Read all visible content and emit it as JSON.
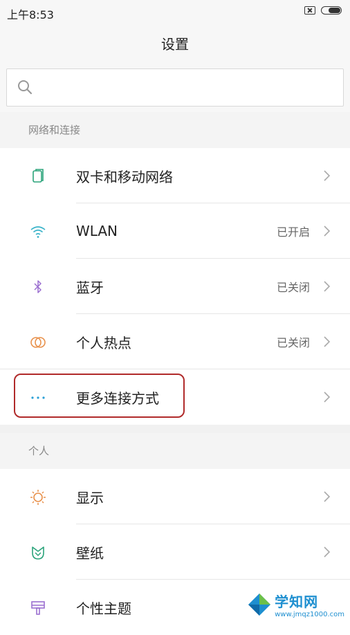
{
  "status_bar": {
    "time": "上午8:53"
  },
  "header": {
    "title": "设置"
  },
  "search": {
    "placeholder": ""
  },
  "sections": [
    {
      "title": "网络和连接",
      "items": [
        {
          "label": "双卡和移动网络",
          "value": "",
          "icon": "dual-sim-icon"
        },
        {
          "label": "WLAN",
          "value": "已开启",
          "icon": "wifi-icon"
        },
        {
          "label": "蓝牙",
          "value": "已关闭",
          "icon": "bluetooth-icon"
        },
        {
          "label": "个人热点",
          "value": "已关闭",
          "icon": "hotspot-icon"
        },
        {
          "label": "更多连接方式",
          "value": "",
          "icon": "more-dots-icon"
        }
      ]
    },
    {
      "title": "个人",
      "items": [
        {
          "label": "显示",
          "value": "",
          "icon": "display-sun-icon"
        },
        {
          "label": "壁纸",
          "value": "",
          "icon": "wallpaper-icon"
        },
        {
          "label": "个性主题",
          "value": "",
          "icon": "theme-brush-icon"
        }
      ]
    }
  ],
  "watermark": {
    "title": "学知网",
    "url": "www.jmqz1000.com"
  },
  "colors": {
    "dual_sim": "#2aa37a",
    "wifi": "#3ab3c9",
    "bluetooth": "#9b6fd0",
    "hotspot": "#e8904a",
    "more": "#2a9fd6",
    "display": "#e8904a",
    "wallpaper": "#2aa37a",
    "theme": "#9b6fd0",
    "highlight": "#b02a2a"
  }
}
